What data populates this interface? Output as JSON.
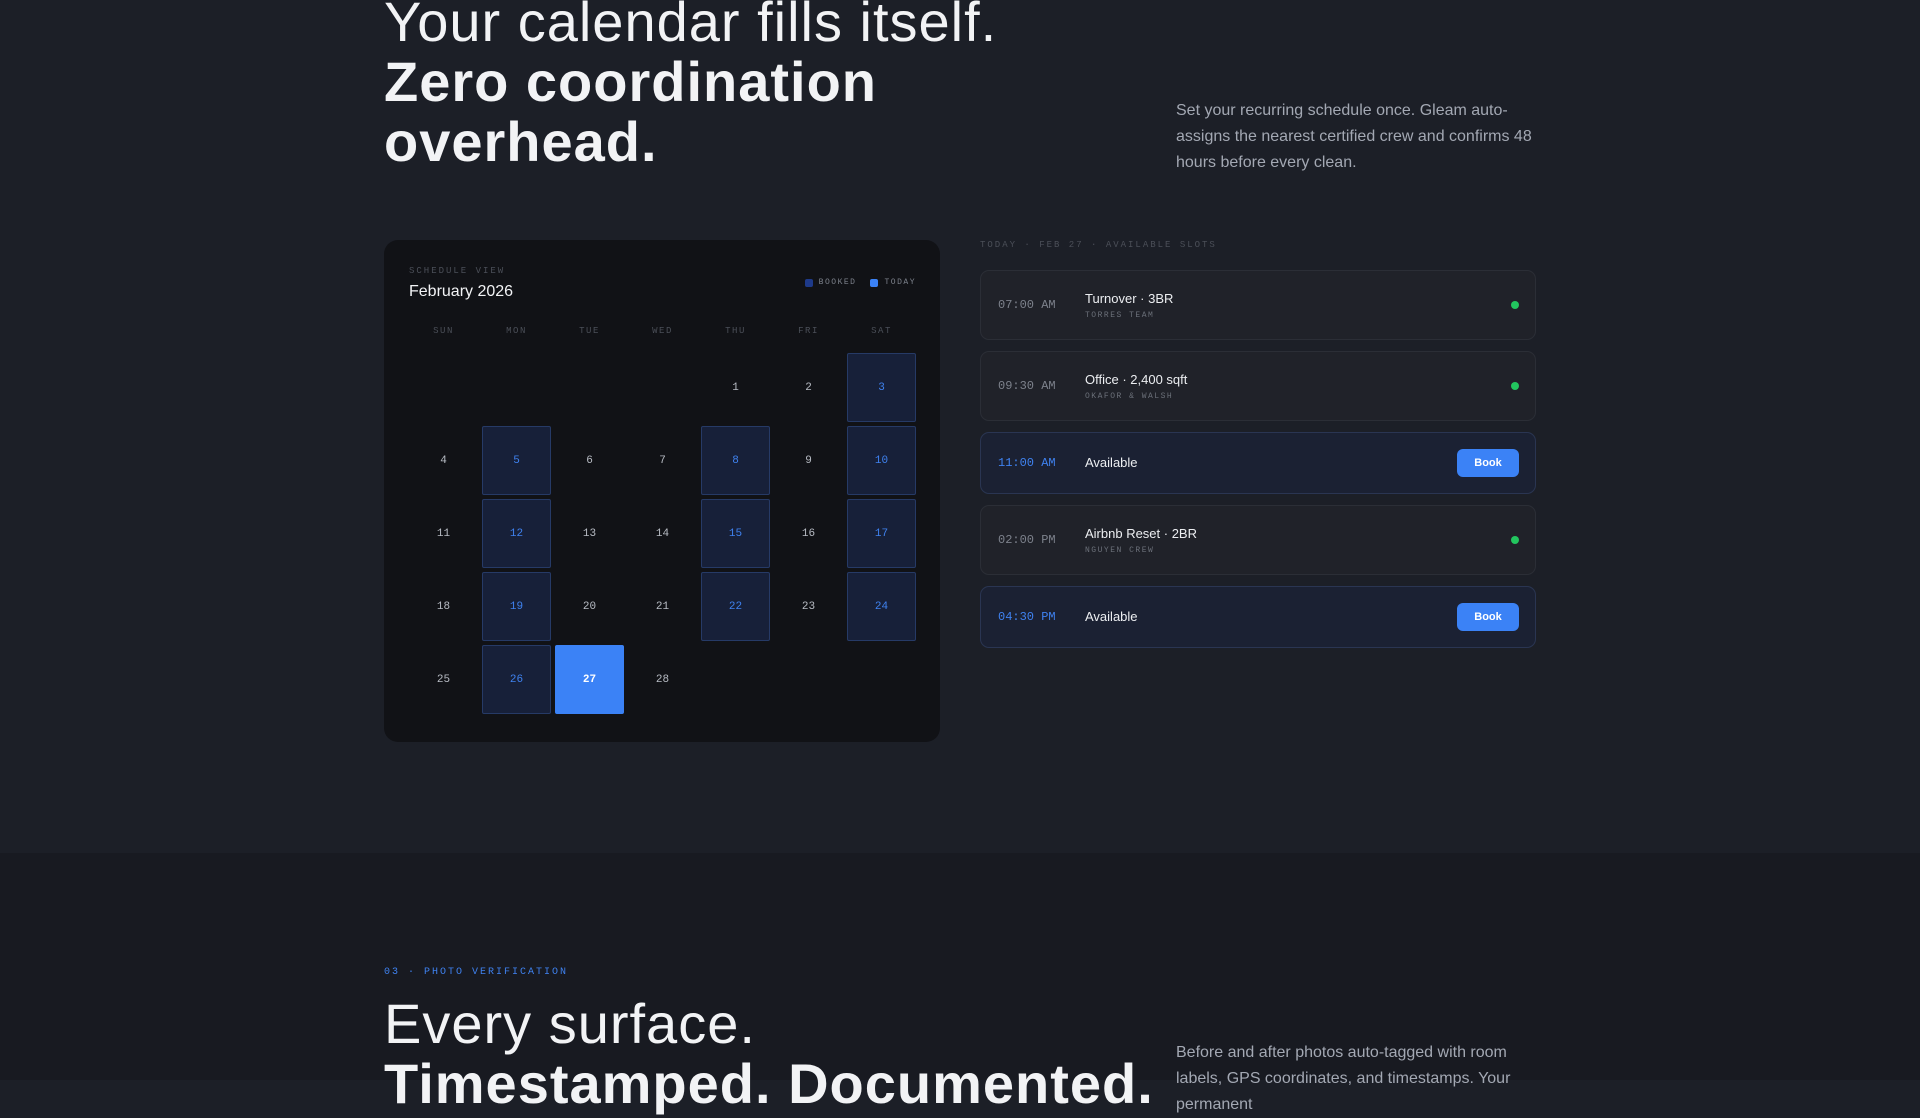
{
  "hero": {
    "headline_light": "Your calendar fills itself.",
    "headline_bold": "Zero coordination overhead.",
    "description": "Set your recurring schedule once. Gleam auto-assigns the nearest certified crew and confirms 48 hours before every clean."
  },
  "calendar": {
    "eyebrow": "SCHEDULE VIEW",
    "month": "February 2026",
    "legend": [
      {
        "label": "BOOKED",
        "color": "#1e3a8a"
      },
      {
        "label": "TODAY",
        "color": "#3b82f6"
      }
    ],
    "weekdays": [
      "SUN",
      "MON",
      "TUE",
      "WED",
      "THU",
      "FRI",
      "SAT"
    ],
    "leading_blanks": 4,
    "days": [
      {
        "n": "1",
        "state": ""
      },
      {
        "n": "2",
        "state": ""
      },
      {
        "n": "3",
        "state": "booked"
      },
      {
        "n": "4",
        "state": ""
      },
      {
        "n": "5",
        "state": "booked"
      },
      {
        "n": "6",
        "state": ""
      },
      {
        "n": "7",
        "state": ""
      },
      {
        "n": "8",
        "state": "booked"
      },
      {
        "n": "9",
        "state": ""
      },
      {
        "n": "10",
        "state": "booked"
      },
      {
        "n": "11",
        "state": ""
      },
      {
        "n": "12",
        "state": "booked"
      },
      {
        "n": "13",
        "state": ""
      },
      {
        "n": "14",
        "state": ""
      },
      {
        "n": "15",
        "state": "booked"
      },
      {
        "n": "16",
        "state": ""
      },
      {
        "n": "17",
        "state": "booked"
      },
      {
        "n": "18",
        "state": ""
      },
      {
        "n": "19",
        "state": "booked"
      },
      {
        "n": "20",
        "state": ""
      },
      {
        "n": "21",
        "state": ""
      },
      {
        "n": "22",
        "state": "booked"
      },
      {
        "n": "23",
        "state": ""
      },
      {
        "n": "24",
        "state": "booked"
      },
      {
        "n": "25",
        "state": ""
      },
      {
        "n": "26",
        "state": "booked"
      },
      {
        "n": "27",
        "state": "today"
      },
      {
        "n": "28",
        "state": ""
      }
    ]
  },
  "slots": {
    "eyebrow": "TODAY · FEB 27 · AVAILABLE SLOTS",
    "items": [
      {
        "time": "07:00 AM",
        "title": "Turnover · 3BR",
        "sub": "TORRES TEAM",
        "available": false
      },
      {
        "time": "09:30 AM",
        "title": "Office · 2,400 sqft",
        "sub": "OKAFOR & WALSH",
        "available": false
      },
      {
        "time": "11:00 AM",
        "title": "Available",
        "sub": "",
        "available": true,
        "button": "Book"
      },
      {
        "time": "02:00 PM",
        "title": "Airbnb Reset · 2BR",
        "sub": "NGUYEN CREW",
        "available": false
      },
      {
        "time": "04:30 PM",
        "title": "Available",
        "sub": "",
        "available": true,
        "button": "Book"
      }
    ]
  },
  "section2": {
    "eyebrow": "03 · PHOTO VERIFICATION",
    "headline_light": "Every surface.",
    "headline_bold": "Timestamped. Documented.",
    "description": "Before and after photos auto-tagged with room labels, GPS coordinates, and timestamps. Your permanent"
  }
}
